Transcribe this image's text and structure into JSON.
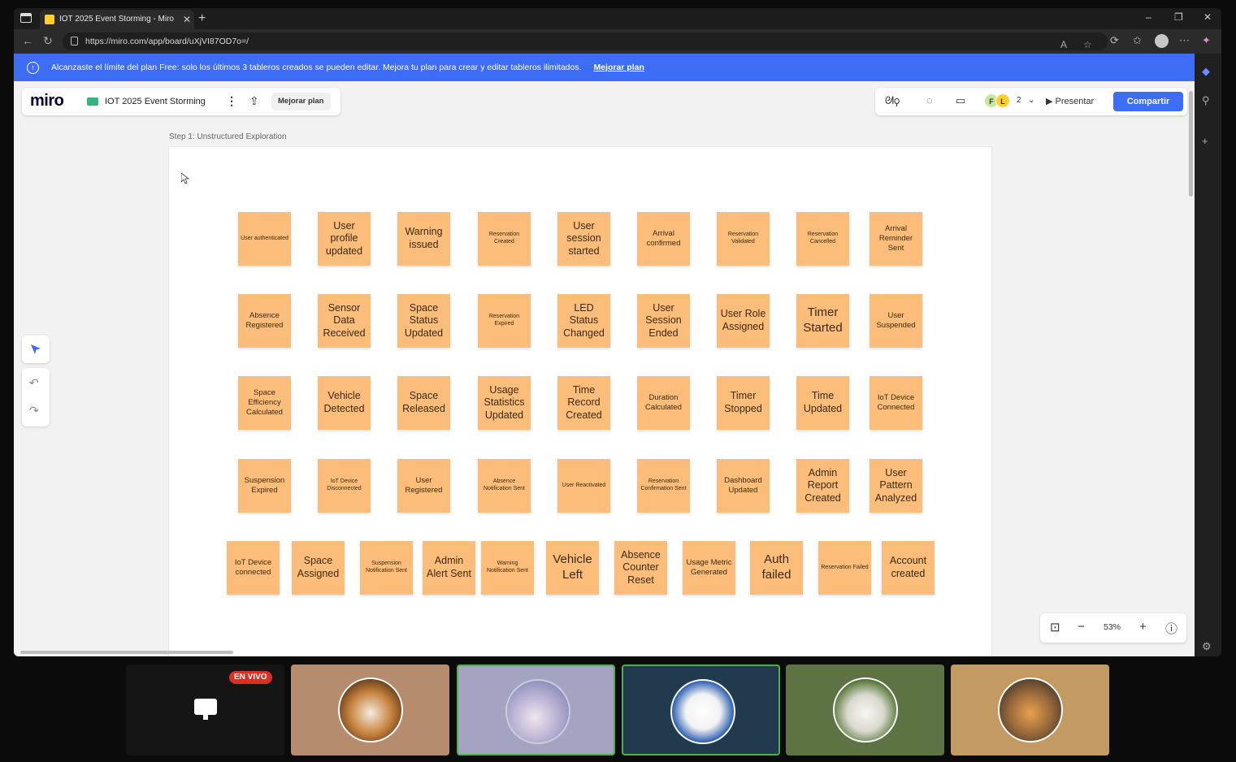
{
  "browser": {
    "tab_title": "IOT 2025 Event Storming - Miro",
    "url": "https://miro.com/app/board/uXjVI87OD7o=/"
  },
  "banner": {
    "text": "Alcanzaste el límite del plan Free: solo los últimos 3 tableros creados se pueden editar. Mejora tu plan para crear y editar tableros ilimitados.",
    "link": "Mejorar plan"
  },
  "toolbar": {
    "logo": "miro",
    "board_title": "IOT 2025 Event Storming",
    "upgrade_label": "Mejorar plan",
    "collab_initials": [
      "F",
      "L"
    ],
    "collab_count": "2",
    "present_label": "Presentar",
    "share_label": "Compartir",
    "accent": "#3d6cf5"
  },
  "frame": {
    "label": "Step 1: Unstructured Exploration"
  },
  "zoom": {
    "value": "53%"
  },
  "sticky_color": "#fdbd7a",
  "stickies": {
    "r1": [
      "User authenticated",
      "User profile updated",
      "Warning issued",
      "Reservation Created",
      "User session started",
      "Arrival confirmed",
      "Reservation Validated",
      "Reservation Cancelled",
      "Arrival Reminder Sent"
    ],
    "r2": [
      "Absence Registered",
      "Sensor Data Received",
      "Space Status Updated",
      "Reservation Expired",
      "LED Status Changed",
      "User Session Ended",
      "User Role Assigned",
      "Timer Started",
      "User Suspended"
    ],
    "r3": [
      "Space Efficiency Calculated",
      "Vehicle Detected",
      "Space Released",
      "Usage Statistics Updated",
      "Time Record Created",
      "Duration Calculated",
      "Timer Stopped",
      "Time Updated",
      "IoT Device Connected"
    ],
    "r4": [
      "Suspension Expired",
      "IoT Device Disconnected",
      "User Registered",
      "Absence Notification Sent",
      "User Reactivated",
      "Reservation Confirmation Sent",
      "Dashboard Updated",
      "Admin Report Created",
      "User Pattern Analyzed"
    ],
    "r5": [
      "IoT Device connected",
      "Space Assigned",
      "Suspension Notification Sent",
      "Admin Alert Sent",
      "Warning Notification Sent",
      "Vehicle Left",
      "Absence Counter Reset",
      "Usage Metric Generated",
      "Auth failed",
      "Reservation Failed",
      "Account created"
    ]
  },
  "meeting": {
    "live_label": "EN VIVO"
  }
}
